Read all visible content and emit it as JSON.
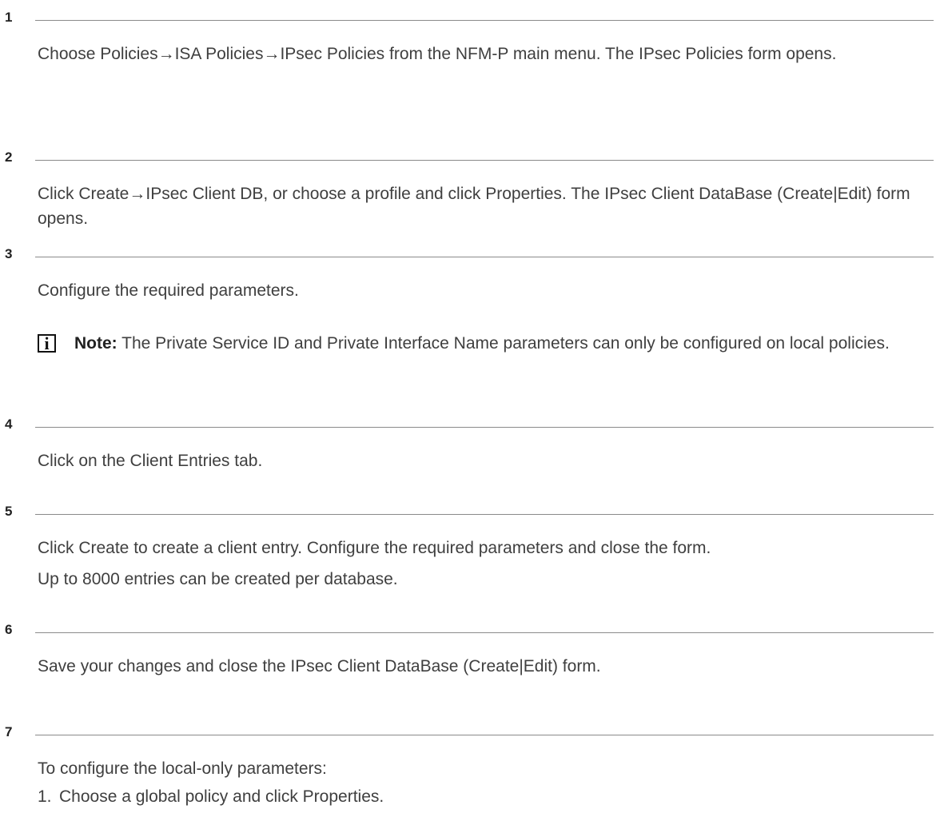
{
  "steps": [
    {
      "number": "1",
      "text": "Choose Policies→ISA Policies→IPsec Policies from the NFM-P main menu. The IPsec Policies form opens."
    },
    {
      "number": "2",
      "text": "Click Create→IPsec Client DB, or choose a profile and click Properties. The IPsec Client DataBase (Create|Edit) form opens."
    },
    {
      "number": "3",
      "text": "Configure the required parameters.",
      "note": {
        "icon": "info-icon",
        "label": "Note:",
        "text": "The Private Service ID and Private Interface Name parameters can only be configured on local policies."
      }
    },
    {
      "number": "4",
      "text": "Click on the Client Entries tab."
    },
    {
      "number": "5",
      "text": "Click Create to create a client entry. Configure the required parameters and close the form.",
      "text2": "Up to 8000 entries can be created per database."
    },
    {
      "number": "6",
      "text": "Save your changes and close the IPsec Client DataBase (Create|Edit) form."
    },
    {
      "number": "7",
      "text": "To configure the local-only parameters:",
      "list": [
        {
          "num": "1.",
          "text": "Choose a global policy and click Properties."
        }
      ]
    }
  ]
}
